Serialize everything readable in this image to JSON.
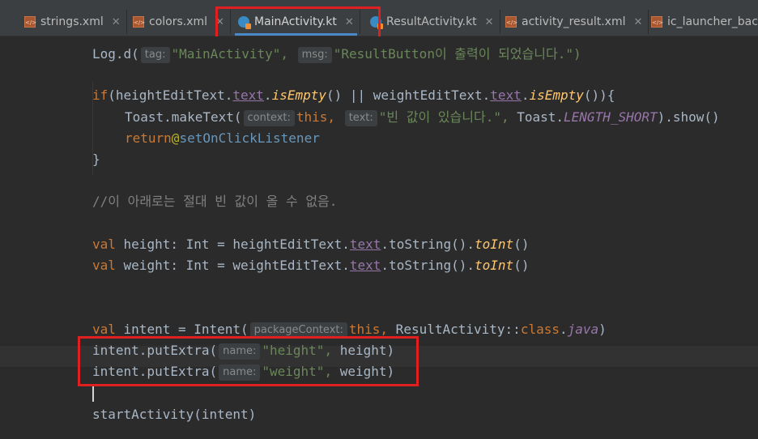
{
  "tabs": [
    {
      "label": "strings.xml"
    },
    {
      "label": "colors.xml"
    },
    {
      "label": "MainActivity.kt"
    },
    {
      "label": "ResultActivity.kt"
    },
    {
      "label": "activity_result.xml"
    },
    {
      "label": "ic_launcher_back"
    }
  ],
  "hints": {
    "tag": "tag:",
    "msg": "msg:",
    "context": "context:",
    "text": "text:",
    "packageContext": "packageContext:",
    "name": "name:"
  },
  "code": {
    "line1_fn": "Log.d(",
    "line1_tag": "\"MainActivity\",",
    "line1_msg": "\"ResultButton이 출력이 되었습니다.\")",
    "line2": "if(heightEditText.text.isEmpty() || weightEditText.text.isEmpty()){",
    "line3_fn": "Toast.makeText(",
    "line3_this": "this,",
    "line3_str": "\"빈 값이 있습니다.\",",
    "line3_rest": "Toast.LENGTH_SHORT).show()",
    "line4": "return@setOnClickListener",
    "line5": "}",
    "comment": "//이 아래로는 절대 빈 값이 올 수 없음.",
    "line6": "val height: Int = heightEditText.text.toString().toInt()",
    "line7": "val weight: Int = weightEditText.text.toString().toInt()",
    "line8_pre": "val intent = Intent(",
    "line8_this": "this,",
    "line8_rest": "ResultActivity::class.java)",
    "line9_pre": "intent.putExtra(",
    "line9_str": "\"height\",",
    "line9_rest": "height)",
    "line10_pre": "intent.putExtra(",
    "line10_str": "\"weight\",",
    "line10_rest": "weight)",
    "line11": "startActivity(intent)"
  },
  "colors": {
    "highlight_box": "#e02020",
    "keyword": "#cc7832",
    "string": "#6a8759",
    "function": "#ffc66d",
    "property": "#9876aa"
  }
}
